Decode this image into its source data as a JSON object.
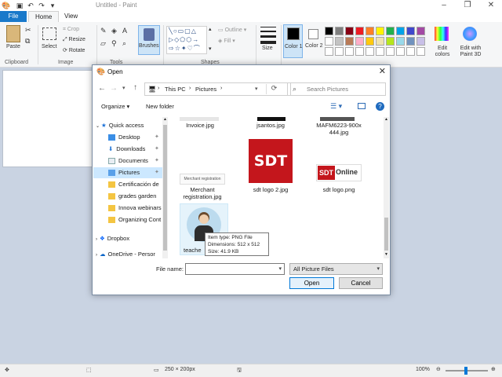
{
  "window": {
    "title": "Untitled - Paint"
  },
  "tabs": {
    "file": "File",
    "home": "Home",
    "view": "View"
  },
  "ribbon": {
    "paste": "Paste",
    "select": "Select",
    "crop": "Crop",
    "resize": "Resize",
    "rotate": "Rotate",
    "brushes": "Brushes",
    "outline": "Outline",
    "fill": "Fill",
    "size": "Size",
    "color1": "Color 1",
    "color2": "Color 2",
    "edit_colors": "Edit colors",
    "edit_paint3d": "Edit with Paint 3D",
    "groups": {
      "clipboard": "Clipboard",
      "image": "Image",
      "tools": "Tools",
      "shapes": "Shapes"
    },
    "colors": [
      "#000000",
      "#7f7f7f",
      "#880015",
      "#ed1c24",
      "#ff7f27",
      "#fff200",
      "#22b14c",
      "#00a2e8",
      "#3f48cc",
      "#a349a4",
      "#ffffff",
      "#c3c3c3",
      "#b97a57",
      "#ffaec9",
      "#ffc90e",
      "#efe4b0",
      "#b5e61d",
      "#99d9ea",
      "#7092be",
      "#c8bfe7"
    ]
  },
  "status": {
    "dimensions": "250 × 200px",
    "zoom": "100%"
  },
  "dialog": {
    "title": "Open",
    "breadcrumb": {
      "root": "This PC",
      "folder": "Pictures"
    },
    "search_placeholder": "Search Pictures",
    "organize": "Organize",
    "new_folder": "New folder",
    "nav": [
      "Quick access",
      "Desktop",
      "Downloads",
      "Documents",
      "Pictures",
      "Certificación de",
      "grades garden",
      "Innova webinars",
      "Organizing Cont",
      "Dropbox",
      "OneDrive - Persor"
    ],
    "files": {
      "invoice": "Invoice.jpg",
      "jsantos": "jsantos.jpg",
      "mafm": "MAFM6223-900x\n444.jpg",
      "merchant": "Merchant\nregistration.jpg",
      "merchant_thumb": "Merchant registration",
      "sdt2": "sdt logo 2.jpg",
      "sdt2_thumb": "SDT",
      "sdtpng": "sdt logo.png",
      "sdtpng_thumb_a": "SDT",
      "sdtpng_thumb_b": "Online",
      "teacher": "teache"
    },
    "tooltip": {
      "type": "Item type: PNG File",
      "dims": "Dimensions: 512 x 512",
      "size": "Size: 41.9 KB"
    },
    "filename_label": "File name:",
    "filename_value": "",
    "filter": "All Picture Files",
    "open": "Open",
    "cancel": "Cancel"
  }
}
